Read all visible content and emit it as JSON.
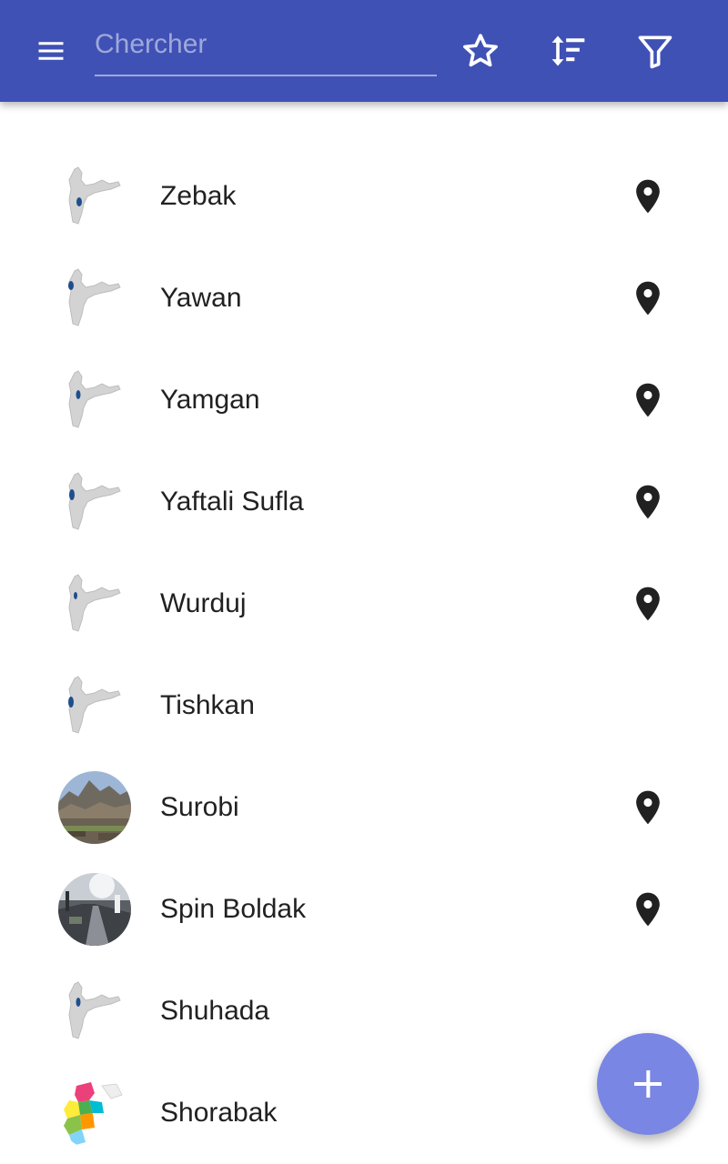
{
  "search": {
    "placeholder": "Chercher",
    "value": ""
  },
  "toolbar": {
    "menu_icon": "menu-icon",
    "favorites_icon": "star-outline-icon",
    "sort_icon": "sort-icon",
    "filter_icon": "filter-icon"
  },
  "colors": {
    "toolbar": "#3f51b5",
    "accent": "#7986e3",
    "text": "#212121",
    "highlight_region": "#1f4e8c"
  },
  "items": [
    {
      "label": "Zebak",
      "thumb": "locator-map",
      "has_location": true
    },
    {
      "label": "Yawan",
      "thumb": "locator-map",
      "has_location": true
    },
    {
      "label": "Yamgan",
      "thumb": "locator-map",
      "has_location": true
    },
    {
      "label": "Yaftali Sufla",
      "thumb": "locator-map",
      "has_location": true
    },
    {
      "label": "Wurduj",
      "thumb": "locator-map",
      "has_location": true
    },
    {
      "label": "Tishkan",
      "thumb": "locator-map",
      "has_location": false
    },
    {
      "label": "Surobi",
      "thumb": "photo-mountains",
      "has_location": true
    },
    {
      "label": "Spin Boldak",
      "thumb": "photo-road",
      "has_location": true
    },
    {
      "label": "Shuhada",
      "thumb": "locator-map",
      "has_location": false
    },
    {
      "label": "Shorabak",
      "thumb": "colored-map",
      "has_location": false
    }
  ],
  "fab": {
    "icon": "add-icon"
  }
}
